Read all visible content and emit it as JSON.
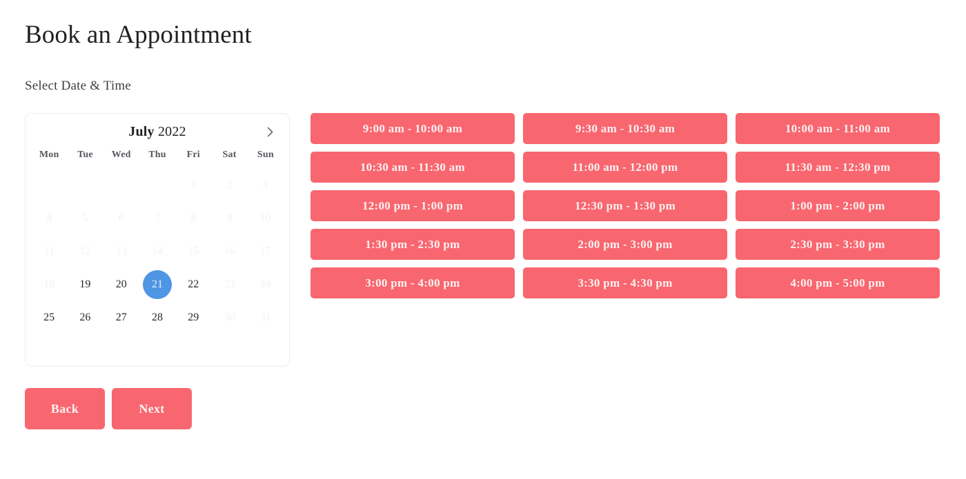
{
  "header": {
    "title": "Book an Appointment",
    "subtitle": "Select Date & Time"
  },
  "calendar": {
    "month": "July",
    "year": "2022",
    "next_icon": "chevron-right-icon",
    "weekdays": [
      "Mon",
      "Tue",
      "Wed",
      "Thu",
      "Fri",
      "Sat",
      "Sun"
    ],
    "selected_day": "21",
    "accent_selected_color": "#4e95e4",
    "disabled_color": "#f1f2f4",
    "weeks": [
      [
        {
          "label": "",
          "state": "empty"
        },
        {
          "label": "",
          "state": "empty"
        },
        {
          "label": "",
          "state": "empty"
        },
        {
          "label": "",
          "state": "empty"
        },
        {
          "label": "1",
          "state": "disabled"
        },
        {
          "label": "2",
          "state": "disabled"
        },
        {
          "label": "3",
          "state": "disabled"
        }
      ],
      [
        {
          "label": "4",
          "state": "disabled"
        },
        {
          "label": "5",
          "state": "disabled"
        },
        {
          "label": "6",
          "state": "disabled"
        },
        {
          "label": "7",
          "state": "disabled"
        },
        {
          "label": "8",
          "state": "disabled"
        },
        {
          "label": "9",
          "state": "disabled"
        },
        {
          "label": "10",
          "state": "disabled"
        }
      ],
      [
        {
          "label": "11",
          "state": "disabled"
        },
        {
          "label": "12",
          "state": "disabled"
        },
        {
          "label": "13",
          "state": "disabled"
        },
        {
          "label": "14",
          "state": "disabled"
        },
        {
          "label": "15",
          "state": "disabled"
        },
        {
          "label": "16",
          "state": "disabled"
        },
        {
          "label": "17",
          "state": "disabled"
        }
      ],
      [
        {
          "label": "18",
          "state": "disabled"
        },
        {
          "label": "19",
          "state": "enabled"
        },
        {
          "label": "20",
          "state": "enabled"
        },
        {
          "label": "21",
          "state": "selected"
        },
        {
          "label": "22",
          "state": "enabled"
        },
        {
          "label": "23",
          "state": "disabled"
        },
        {
          "label": "24",
          "state": "disabled"
        }
      ],
      [
        {
          "label": "25",
          "state": "enabled"
        },
        {
          "label": "26",
          "state": "enabled"
        },
        {
          "label": "27",
          "state": "enabled"
        },
        {
          "label": "28",
          "state": "enabled"
        },
        {
          "label": "29",
          "state": "enabled"
        },
        {
          "label": "30",
          "state": "disabled"
        },
        {
          "label": "31",
          "state": "disabled"
        }
      ],
      [
        {
          "label": "",
          "state": "empty"
        },
        {
          "label": "",
          "state": "empty"
        },
        {
          "label": "",
          "state": "empty"
        },
        {
          "label": "",
          "state": "empty"
        },
        {
          "label": "",
          "state": "empty"
        },
        {
          "label": "",
          "state": "empty"
        },
        {
          "label": "",
          "state": "empty"
        }
      ]
    ]
  },
  "time_slots": {
    "color": "#f8666f",
    "text_color": "#fdf1f1",
    "items": [
      "9:00 am - 10:00 am",
      "9:30 am - 10:30 am",
      "10:00 am - 11:00 am",
      "10:30 am - 11:30 am",
      "11:00 am - 12:00 pm",
      "11:30 am - 12:30 pm",
      "12:00 pm - 1:00 pm",
      "12:30 pm - 1:30 pm",
      "1:00 pm - 2:00 pm",
      "1:30 pm - 2:30 pm",
      "2:00 pm - 3:00 pm",
      "2:30 pm - 3:30 pm",
      "3:00 pm - 4:00 pm",
      "3:30 pm - 4:30 pm",
      "4:00 pm - 5:00 pm"
    ]
  },
  "footer": {
    "back_label": "Back",
    "next_label": "Next"
  }
}
